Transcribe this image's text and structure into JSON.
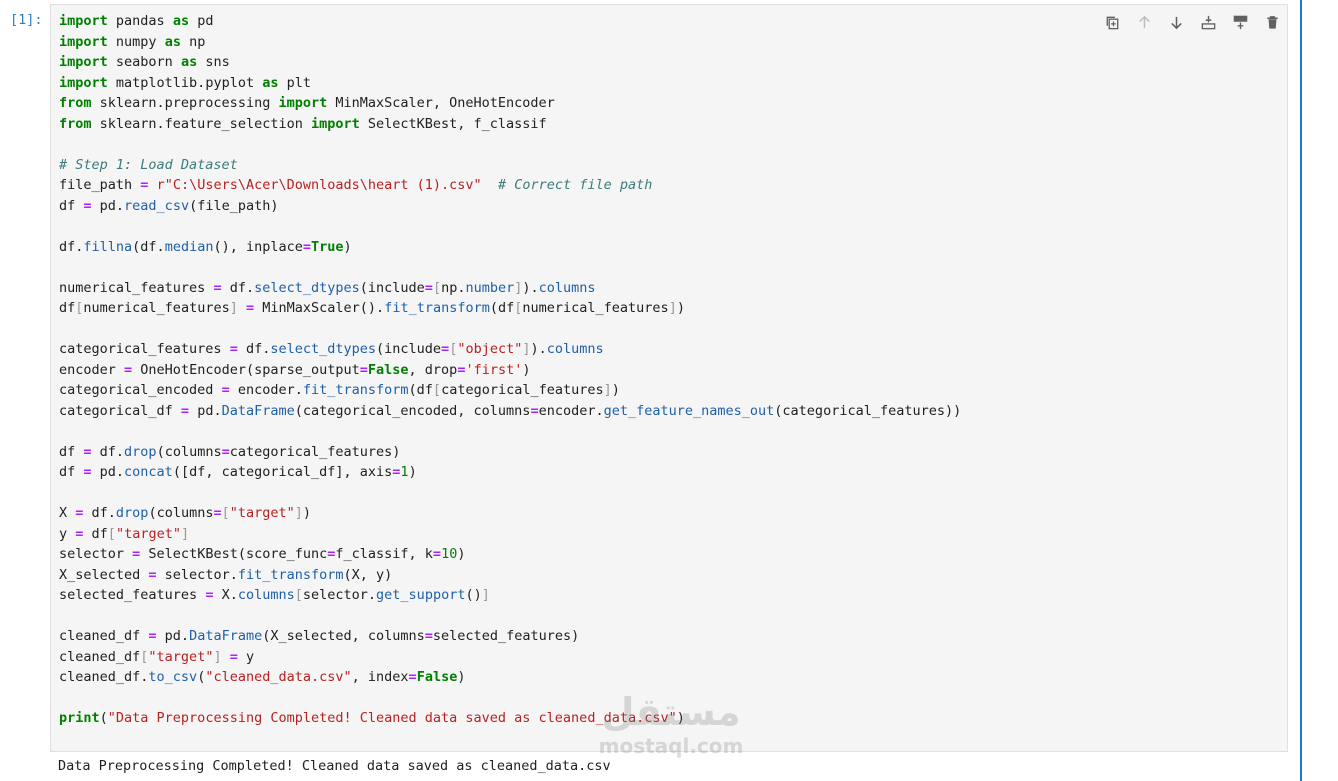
{
  "cell": {
    "prompt": "[1]:",
    "code_lines": [
      [
        [
          "kw",
          "import"
        ],
        [
          "t",
          " pandas "
        ],
        [
          "kw",
          "as"
        ],
        [
          "t",
          " pd"
        ]
      ],
      [
        [
          "kw",
          "import"
        ],
        [
          "t",
          " numpy "
        ],
        [
          "kw",
          "as"
        ],
        [
          "t",
          " np"
        ]
      ],
      [
        [
          "kw",
          "import"
        ],
        [
          "t",
          " seaborn "
        ],
        [
          "kw",
          "as"
        ],
        [
          "t",
          " sns"
        ]
      ],
      [
        [
          "kw",
          "import"
        ],
        [
          "t",
          " matplotlib.pyplot "
        ],
        [
          "kw",
          "as"
        ],
        [
          "t",
          " plt"
        ]
      ],
      [
        [
          "kw",
          "from"
        ],
        [
          "t",
          " sklearn.preprocessing "
        ],
        [
          "kw",
          "import"
        ],
        [
          "t",
          " MinMaxScaler, OneHotEncoder"
        ]
      ],
      [
        [
          "kw",
          "from"
        ],
        [
          "t",
          " sklearn.feature_selection "
        ],
        [
          "kw",
          "import"
        ],
        [
          "t",
          " SelectKBest, f_classif"
        ]
      ],
      [],
      [
        [
          "cm",
          "# Step 1: Load Dataset"
        ]
      ],
      [
        [
          "t",
          "file_path "
        ],
        [
          "op",
          "="
        ],
        [
          "t",
          " "
        ],
        [
          "str",
          "r\"C:\\Users\\Acer\\Downloads\\heart (1).csv\""
        ],
        [
          "t",
          "  "
        ],
        [
          "cm",
          "# Correct file path"
        ]
      ],
      [
        [
          "t",
          "df "
        ],
        [
          "op",
          "="
        ],
        [
          "t",
          " pd."
        ],
        [
          "fn",
          "read_csv"
        ],
        [
          "t",
          "(file_path)"
        ]
      ],
      [],
      [
        [
          "t",
          "df."
        ],
        [
          "fn",
          "fillna"
        ],
        [
          "t",
          "(df."
        ],
        [
          "fn",
          "median"
        ],
        [
          "t",
          "(), inplace"
        ],
        [
          "op",
          "="
        ],
        [
          "kw",
          "True"
        ],
        [
          "t",
          ")"
        ]
      ],
      [],
      [
        [
          "t",
          "numerical_features "
        ],
        [
          "op",
          "="
        ],
        [
          "t",
          " df."
        ],
        [
          "fn",
          "select_dtypes"
        ],
        [
          "t",
          "(include"
        ],
        [
          "op",
          "="
        ],
        [
          "br",
          "["
        ],
        [
          "t",
          "np."
        ],
        [
          "fn",
          "number"
        ],
        [
          "br",
          "]"
        ],
        [
          "t",
          ")."
        ],
        [
          "fn",
          "columns"
        ]
      ],
      [
        [
          "t",
          "df"
        ],
        [
          "br",
          "["
        ],
        [
          "t",
          "numerical_features"
        ],
        [
          "br",
          "]"
        ],
        [
          "t",
          " "
        ],
        [
          "op",
          "="
        ],
        [
          "t",
          " MinMaxScaler()."
        ],
        [
          "fn",
          "fit_transform"
        ],
        [
          "t",
          "(df"
        ],
        [
          "br",
          "["
        ],
        [
          "t",
          "numerical_features"
        ],
        [
          "br",
          "]"
        ],
        [
          "t",
          ")"
        ]
      ],
      [],
      [
        [
          "t",
          "categorical_features "
        ],
        [
          "op",
          "="
        ],
        [
          "t",
          " df."
        ],
        [
          "fn",
          "select_dtypes"
        ],
        [
          "t",
          "(include"
        ],
        [
          "op",
          "="
        ],
        [
          "br",
          "["
        ],
        [
          "str",
          "\"object\""
        ],
        [
          "br",
          "]"
        ],
        [
          "t",
          ")."
        ],
        [
          "fn",
          "columns"
        ]
      ],
      [
        [
          "t",
          "encoder "
        ],
        [
          "op",
          "="
        ],
        [
          "t",
          " OneHotEncoder(sparse_output"
        ],
        [
          "op",
          "="
        ],
        [
          "kw",
          "False"
        ],
        [
          "t",
          ", drop"
        ],
        [
          "op",
          "="
        ],
        [
          "str",
          "'first'"
        ],
        [
          "t",
          ")"
        ]
      ],
      [
        [
          "t",
          "categorical_encoded "
        ],
        [
          "op",
          "="
        ],
        [
          "t",
          " encoder."
        ],
        [
          "fn",
          "fit_transform"
        ],
        [
          "t",
          "(df"
        ],
        [
          "br",
          "["
        ],
        [
          "t",
          "categorical_features"
        ],
        [
          "br",
          "]"
        ],
        [
          "t",
          ")"
        ]
      ],
      [
        [
          "t",
          "categorical_df "
        ],
        [
          "op",
          "="
        ],
        [
          "t",
          " pd."
        ],
        [
          "fn",
          "DataFrame"
        ],
        [
          "t",
          "(categorical_encoded, columns"
        ],
        [
          "op",
          "="
        ],
        [
          "t",
          "encoder."
        ],
        [
          "fn",
          "get_feature_names_out"
        ],
        [
          "t",
          "(categorical_features))"
        ]
      ],
      [],
      [
        [
          "t",
          "df "
        ],
        [
          "op",
          "="
        ],
        [
          "t",
          " df."
        ],
        [
          "fn",
          "drop"
        ],
        [
          "t",
          "(columns"
        ],
        [
          "op",
          "="
        ],
        [
          "t",
          "categorical_features)"
        ]
      ],
      [
        [
          "t",
          "df "
        ],
        [
          "op",
          "="
        ],
        [
          "t",
          " pd."
        ],
        [
          "fn",
          "concat"
        ],
        [
          "t",
          "([df, categorical_df], axis"
        ],
        [
          "op",
          "="
        ],
        [
          "num",
          "1"
        ],
        [
          "t",
          ")"
        ]
      ],
      [],
      [
        [
          "t",
          "X "
        ],
        [
          "op",
          "="
        ],
        [
          "t",
          " df."
        ],
        [
          "fn",
          "drop"
        ],
        [
          "t",
          "(columns"
        ],
        [
          "op",
          "="
        ],
        [
          "br",
          "["
        ],
        [
          "str",
          "\"target\""
        ],
        [
          "br",
          "]"
        ],
        [
          "t",
          ")"
        ]
      ],
      [
        [
          "t",
          "y "
        ],
        [
          "op",
          "="
        ],
        [
          "t",
          " df"
        ],
        [
          "br",
          "["
        ],
        [
          "str",
          "\"target\""
        ],
        [
          "br",
          "]"
        ]
      ],
      [
        [
          "t",
          "selector "
        ],
        [
          "op",
          "="
        ],
        [
          "t",
          " SelectKBest(score_func"
        ],
        [
          "op",
          "="
        ],
        [
          "t",
          "f_classif, k"
        ],
        [
          "op",
          "="
        ],
        [
          "num",
          "10"
        ],
        [
          "t",
          ")"
        ]
      ],
      [
        [
          "t",
          "X_selected "
        ],
        [
          "op",
          "="
        ],
        [
          "t",
          " selector."
        ],
        [
          "fn",
          "fit_transform"
        ],
        [
          "t",
          "(X, y)"
        ]
      ],
      [
        [
          "t",
          "selected_features "
        ],
        [
          "op",
          "="
        ],
        [
          "t",
          " X."
        ],
        [
          "fn",
          "columns"
        ],
        [
          "br",
          "["
        ],
        [
          "t",
          "selector."
        ],
        [
          "fn",
          "get_support"
        ],
        [
          "t",
          "()"
        ],
        [
          "br",
          "]"
        ]
      ],
      [],
      [
        [
          "t",
          "cleaned_df "
        ],
        [
          "op",
          "="
        ],
        [
          "t",
          " pd."
        ],
        [
          "fn",
          "DataFrame"
        ],
        [
          "t",
          "(X_selected, columns"
        ],
        [
          "op",
          "="
        ],
        [
          "t",
          "selected_features)"
        ]
      ],
      [
        [
          "t",
          "cleaned_df"
        ],
        [
          "br",
          "["
        ],
        [
          "str",
          "\"target\""
        ],
        [
          "br",
          "]"
        ],
        [
          "t",
          " "
        ],
        [
          "op",
          "="
        ],
        [
          "t",
          " y"
        ]
      ],
      [
        [
          "t",
          "cleaned_df."
        ],
        [
          "fn",
          "to_csv"
        ],
        [
          "t",
          "("
        ],
        [
          "str",
          "\"cleaned_data.csv\""
        ],
        [
          "t",
          ", index"
        ],
        [
          "op",
          "="
        ],
        [
          "kw",
          "False"
        ],
        [
          "t",
          ")"
        ]
      ],
      [],
      [
        [
          "kw",
          "print"
        ],
        [
          "t",
          "("
        ],
        [
          "str",
          "\"Data Preprocessing Completed! Cleaned data saved as cleaned_data.csv\""
        ],
        [
          "t",
          ")"
        ]
      ]
    ],
    "output": "Data Preprocessing Completed! Cleaned data saved as cleaned_data.csv"
  },
  "toolbar": {
    "buttons": [
      {
        "icon": "duplicate-icon",
        "title": "Duplicate cell"
      },
      {
        "icon": "arrow-up-icon",
        "title": "Move cell up"
      },
      {
        "icon": "arrow-down-icon",
        "title": "Move cell down"
      },
      {
        "icon": "insert-above-icon",
        "title": "Add cell above"
      },
      {
        "icon": "insert-below-icon",
        "title": "Add cell below"
      },
      {
        "icon": "trash-icon",
        "title": "Delete cell"
      }
    ]
  },
  "watermark": {
    "arabic": "مستقل",
    "latin": "mostaql.com"
  },
  "colors": {
    "accent": "#1976d2",
    "prompt": "#307fc1",
    "editor_bg": "#f5f5f5"
  }
}
